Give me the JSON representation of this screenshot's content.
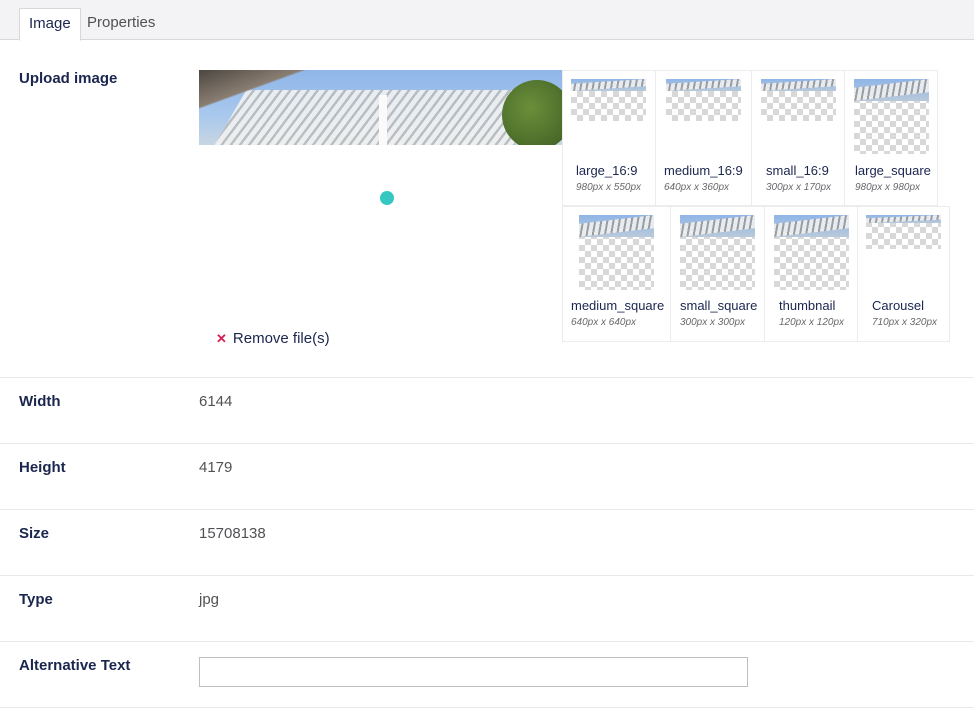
{
  "tabs": [
    {
      "label": "Image",
      "active": true
    },
    {
      "label": "Properties",
      "active": false
    }
  ],
  "upload": {
    "label": "Upload image",
    "remove_label": "Remove file(s)",
    "remove_icon": "close-icon"
  },
  "crops": [
    {
      "name": "large_16:9",
      "dims": "980px x 550px"
    },
    {
      "name": "medium_16:9",
      "dims": "640px x 360px"
    },
    {
      "name": "small_16:9",
      "dims": "300px x 170px"
    },
    {
      "name": "large_square",
      "dims": "980px x 980px"
    },
    {
      "name": "medium_square",
      "dims": "640px x 640px"
    },
    {
      "name": "small_square",
      "dims": "300px x 300px"
    },
    {
      "name": "thumbnail",
      "dims": "120px x 120px"
    },
    {
      "name": "Carousel",
      "dims": "710px x 320px"
    }
  ],
  "fields": {
    "width": {
      "label": "Width",
      "value": "6144"
    },
    "height": {
      "label": "Height",
      "value": "4179"
    },
    "size": {
      "label": "Size",
      "value": "15708138"
    },
    "type": {
      "label": "Type",
      "value": "jpg"
    },
    "alt": {
      "label": "Alternative Text",
      "value": ""
    }
  },
  "colors": {
    "accent_teal": "#35c8c2",
    "remove_red": "#d42054",
    "text_dark": "#1b264f"
  }
}
